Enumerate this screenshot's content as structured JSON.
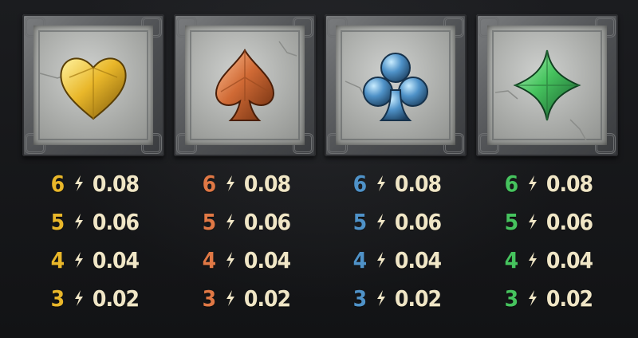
{
  "colors": {
    "background": "#17181b",
    "value_text": "#f0e6c6",
    "heart": "#e9b72a",
    "spade": "#e07845",
    "club": "#4f92c8",
    "diamond": "#46c35e"
  },
  "columns": [
    {
      "icon": "heart-icon",
      "accent": "#e9b72a",
      "rows": [
        {
          "count": "6",
          "value": "0.08"
        },
        {
          "count": "5",
          "value": "0.06"
        },
        {
          "count": "4",
          "value": "0.04"
        },
        {
          "count": "3",
          "value": "0.02"
        }
      ]
    },
    {
      "icon": "spade-icon",
      "accent": "#e07845",
      "rows": [
        {
          "count": "6",
          "value": "0.08"
        },
        {
          "count": "5",
          "value": "0.06"
        },
        {
          "count": "4",
          "value": "0.04"
        },
        {
          "count": "3",
          "value": "0.02"
        }
      ]
    },
    {
      "icon": "club-icon",
      "accent": "#4f92c8",
      "rows": [
        {
          "count": "6",
          "value": "0.08"
        },
        {
          "count": "5",
          "value": "0.06"
        },
        {
          "count": "4",
          "value": "0.04"
        },
        {
          "count": "3",
          "value": "0.02"
        }
      ]
    },
    {
      "icon": "diamond-icon",
      "accent": "#46c35e",
      "rows": [
        {
          "count": "6",
          "value": "0.08"
        },
        {
          "count": "5",
          "value": "0.06"
        },
        {
          "count": "4",
          "value": "0.04"
        },
        {
          "count": "3",
          "value": "0.02"
        }
      ]
    }
  ]
}
